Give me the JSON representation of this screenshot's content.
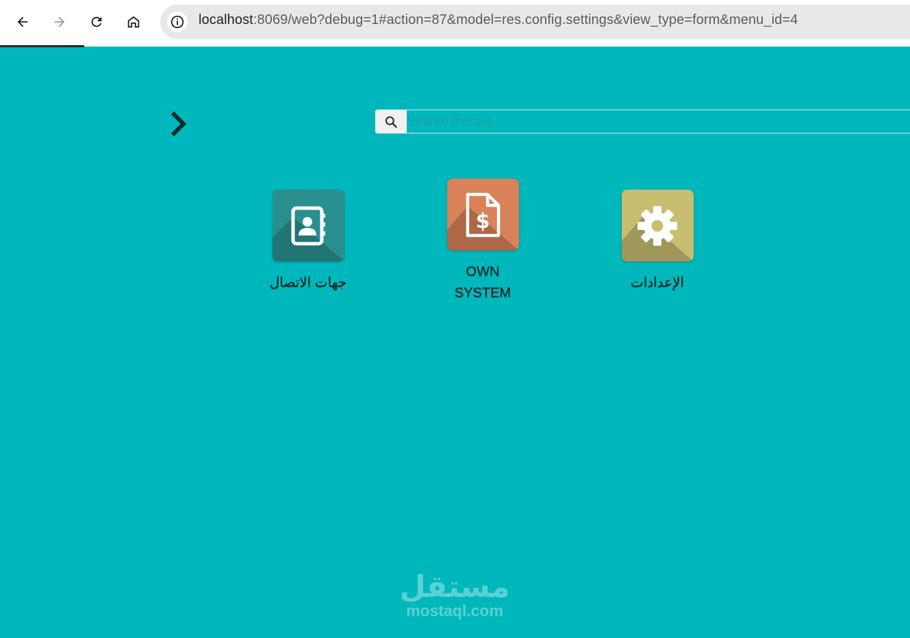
{
  "browser": {
    "url_host": "localhost",
    "url_rest": ":8069/web?debug=1#action=87&model=res.config.settings&view_type=form&menu_id=4",
    "icons": [
      "back-icon",
      "forward-icon",
      "reload-icon",
      "home-icon",
      "info-icon"
    ]
  },
  "search": {
    "placeholder": "Search menus...",
    "icon": "search-icon"
  },
  "apps": [
    {
      "label": "جهات الاتصال",
      "icon": "contacts-icon",
      "color": "#2a8f8f"
    },
    {
      "label_line1": "OWN",
      "label_line2": "SYSTEM",
      "icon": "invoice-icon",
      "color": "#d9825a"
    },
    {
      "label": "الإعدادات",
      "icon": "gear-icon",
      "color": "#c9bd72"
    }
  ],
  "watermark": {
    "arabic": "مستقل",
    "latin": "mostaql.com"
  },
  "colors": {
    "background": "#00b8bb",
    "accent": "#1f1f1f"
  }
}
